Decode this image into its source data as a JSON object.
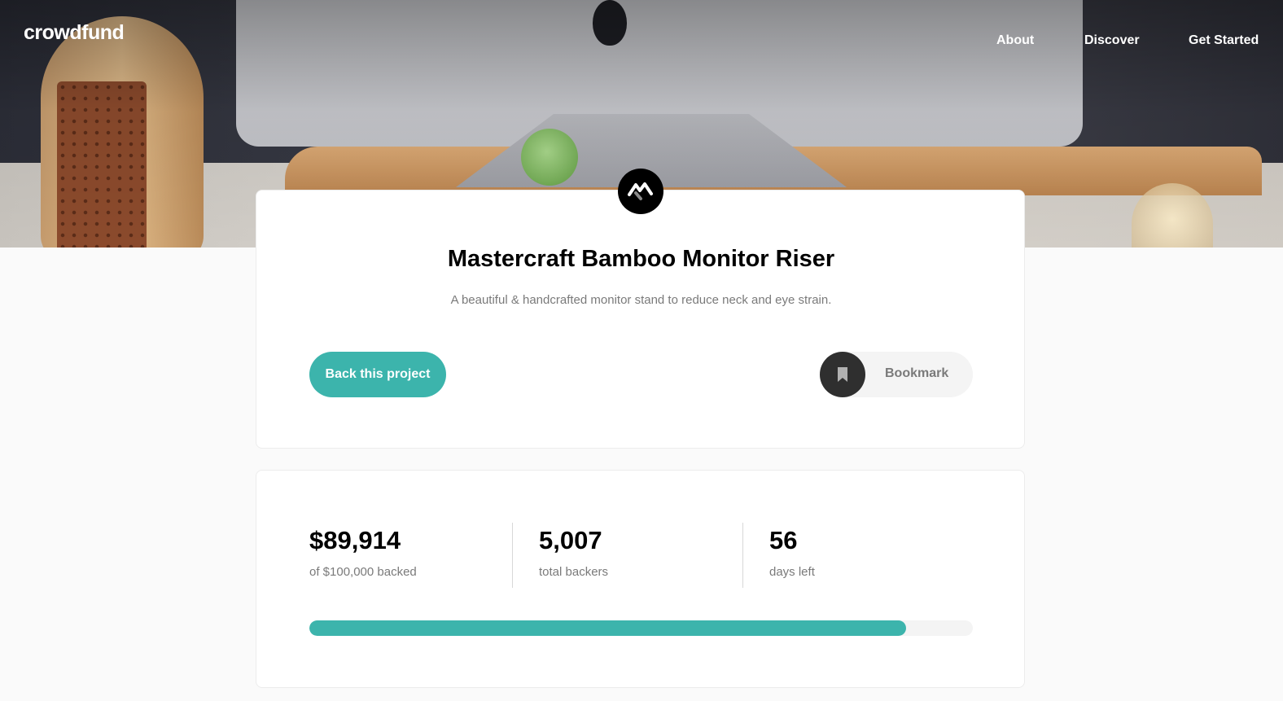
{
  "header": {
    "brand": "crowdfund",
    "nav": [
      {
        "label": "About"
      },
      {
        "label": "Discover"
      },
      {
        "label": "Get Started"
      }
    ]
  },
  "project": {
    "title": "Mastercraft Bamboo Monitor Riser",
    "description": "A beautiful & handcrafted monitor stand to reduce neck and eye strain.",
    "back_label": "Back this project",
    "bookmark_label": "Bookmark"
  },
  "stats": {
    "backed_amount": "$89,914",
    "backed_label": "of $100,000 backed",
    "backers": "5,007",
    "backers_label": "total backers",
    "days": "56",
    "days_label": "days left",
    "progress_fraction": 0.89914
  },
  "colors": {
    "accent": "#3cb4ac",
    "dark": "#2f2f2f",
    "muted_text": "#7a7a7a"
  },
  "icons": {
    "logo": "mastercraft-logo-icon",
    "bookmark": "bookmark-icon"
  }
}
